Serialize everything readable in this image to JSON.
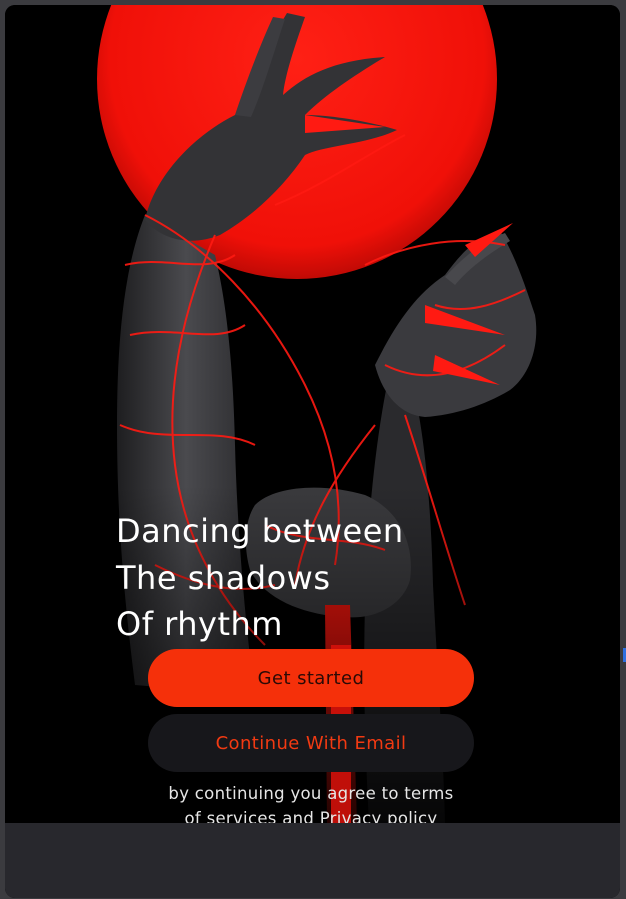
{
  "hero": {
    "line1": "Dancing between",
    "line2": "The shadows",
    "line3": "Of rhythm"
  },
  "buttons": {
    "get_started": "Get started",
    "continue_email": "Continue With Email"
  },
  "terms": {
    "line1": "by continuing you agree to terms",
    "line2_prefix": "of services and",
    "privacy_link": "Privacy policy"
  },
  "colors": {
    "accent": "#f5300a",
    "moon": "#ff1a10",
    "background": "#000000",
    "secondary_button": "#17171b",
    "bottom_bar": "#28282d"
  },
  "illustration": {
    "subject": "red moon with dark clawed hands bound by red threads"
  }
}
